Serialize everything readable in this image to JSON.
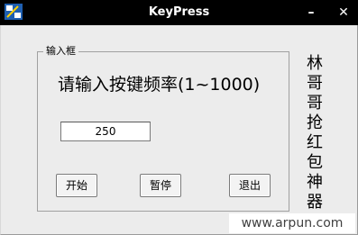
{
  "window": {
    "title": "KeyPress",
    "minimize_symbol": "–",
    "close_symbol": "✕"
  },
  "group": {
    "label": "输入框"
  },
  "prompt": "请输入按键频率(1~1000)",
  "frequency_input": {
    "value": "250"
  },
  "buttons": {
    "start": "开始",
    "pause": "暂停",
    "exit": "退出"
  },
  "side_text": "林哥哥抢红包神器",
  "watermark": "www.arpun.com",
  "colors": {
    "titlebar": "#000000",
    "window_bg": "#ececec"
  },
  "icons": [
    "app-icon",
    "minimize-icon",
    "close-icon"
  ]
}
